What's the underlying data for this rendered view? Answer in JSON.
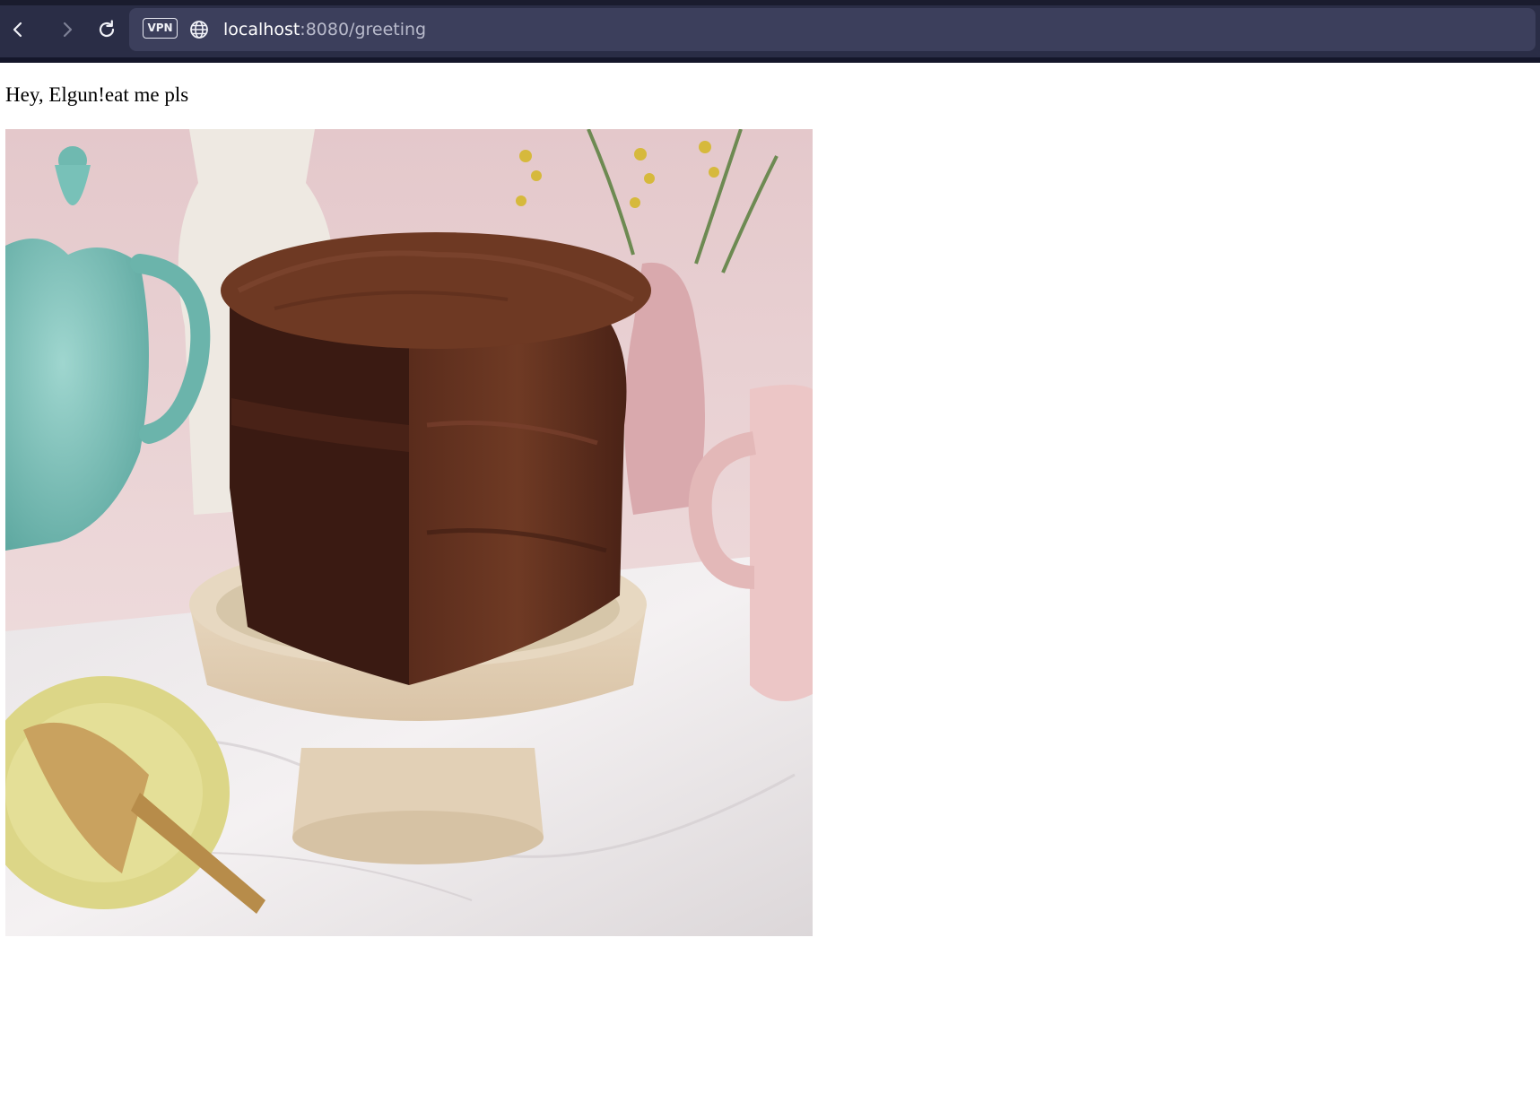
{
  "browser": {
    "vpn_label": "VPN",
    "url_host": "localhost",
    "url_path": ":8080/greeting",
    "icons": {
      "back": "chevron-left-icon",
      "forward": "chevron-right-icon",
      "reload": "reload-icon",
      "site": "globe-icon"
    }
  },
  "page": {
    "greeting_text": "Hey, Elgun!eat me pls",
    "image_subject": "chocolate-cake"
  },
  "colors": {
    "browser_chrome": "#2a2d46",
    "address_bar": "#3c3f5c",
    "page_background": "#ffffff"
  }
}
